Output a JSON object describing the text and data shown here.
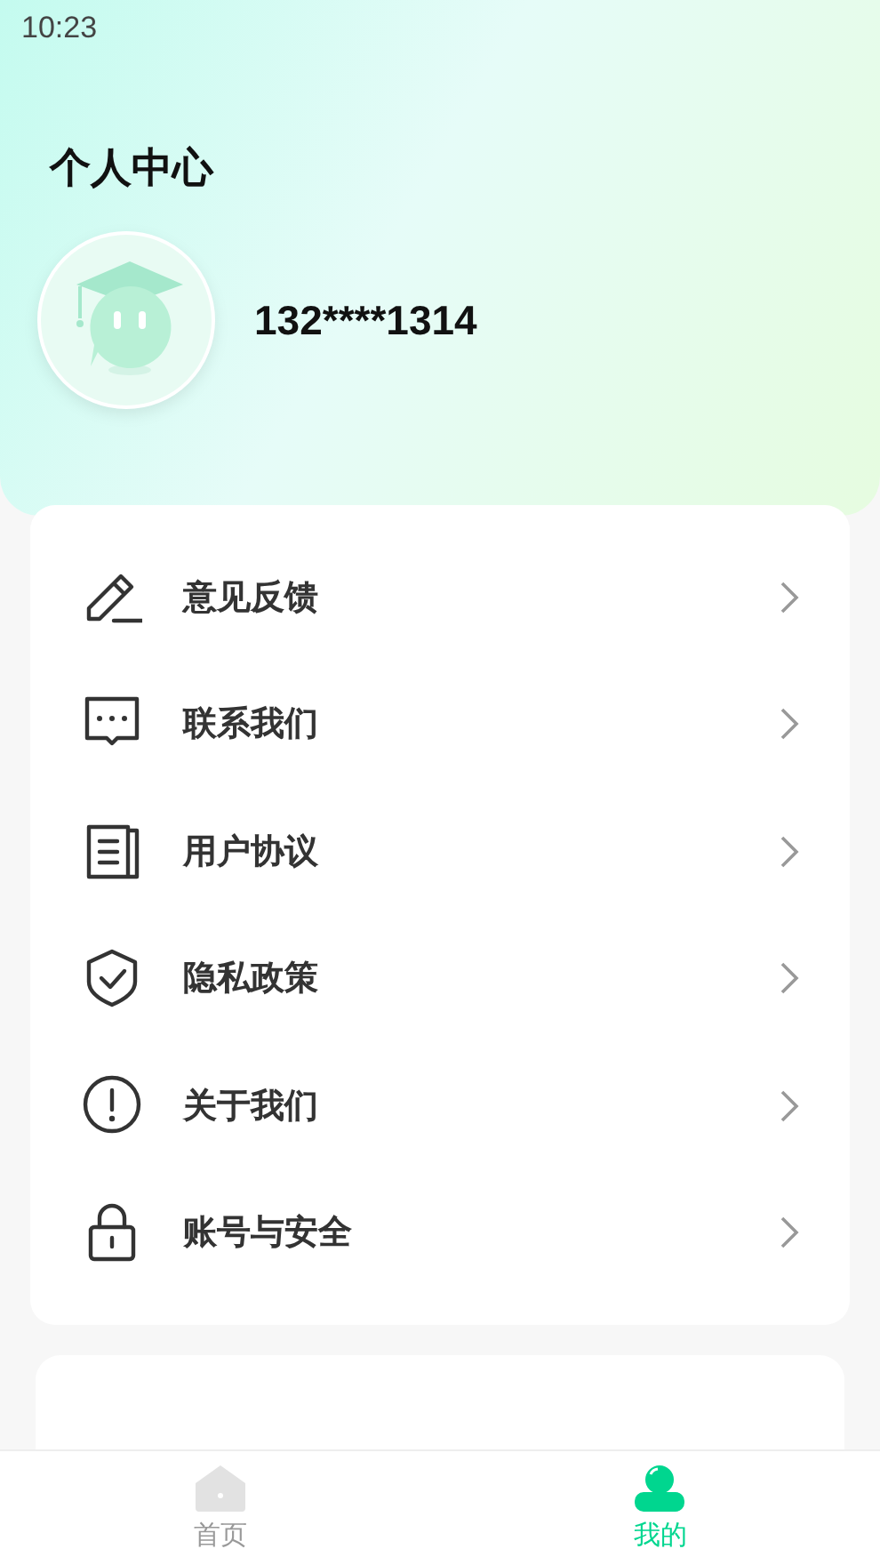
{
  "status_bar": {
    "time": "10:23"
  },
  "header": {
    "title": "个人中心",
    "phone": "132****1314"
  },
  "menu": [
    {
      "label": "意见反馈"
    },
    {
      "label": "联系我们"
    },
    {
      "label": "用户协议"
    },
    {
      "label": "隐私政策"
    },
    {
      "label": "关于我们"
    },
    {
      "label": "账号与安全"
    }
  ],
  "tabs": [
    {
      "kind": "home",
      "label": "首页",
      "selected": false
    },
    {
      "kind": "me",
      "label": "我的",
      "selected": true
    }
  ]
}
